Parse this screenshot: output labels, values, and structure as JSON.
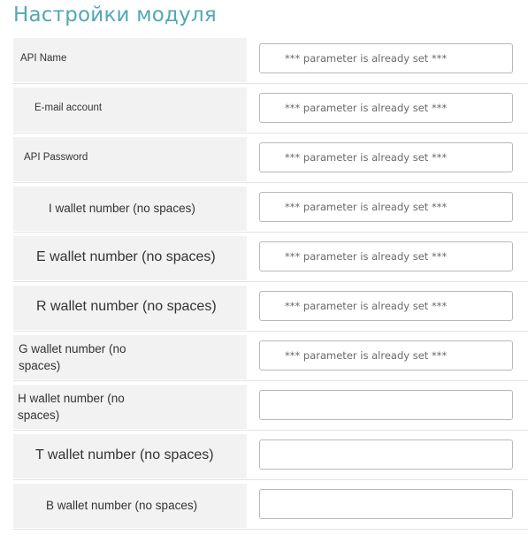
{
  "page": {
    "title": "Настройки модуля"
  },
  "fields": [
    {
      "label": "API Name",
      "value": "",
      "placeholder": "*** parameter is already set ***"
    },
    {
      "label": "E-mail account",
      "value": "",
      "placeholder": "*** parameter is already set ***"
    },
    {
      "label": "API Password",
      "value": "",
      "placeholder": "*** parameter is already set ***"
    },
    {
      "label": "I wallet number (no spaces)",
      "value": "",
      "placeholder": "*** parameter is already set ***"
    },
    {
      "label": "E wallet number (no spaces)",
      "value": "",
      "placeholder": "*** parameter is already set ***"
    },
    {
      "label": "R wallet number (no spaces)",
      "value": "",
      "placeholder": "*** parameter is already set ***"
    },
    {
      "label": "G wallet number (no spaces)",
      "value": "",
      "placeholder": "*** parameter is already set ***"
    },
    {
      "label": "H wallet number (no spaces)",
      "value": "",
      "placeholder": ""
    },
    {
      "label": "T wallet number (no spaces)",
      "value": "",
      "placeholder": ""
    },
    {
      "label": "B wallet number (no spaces)",
      "value": "",
      "placeholder": ""
    }
  ]
}
